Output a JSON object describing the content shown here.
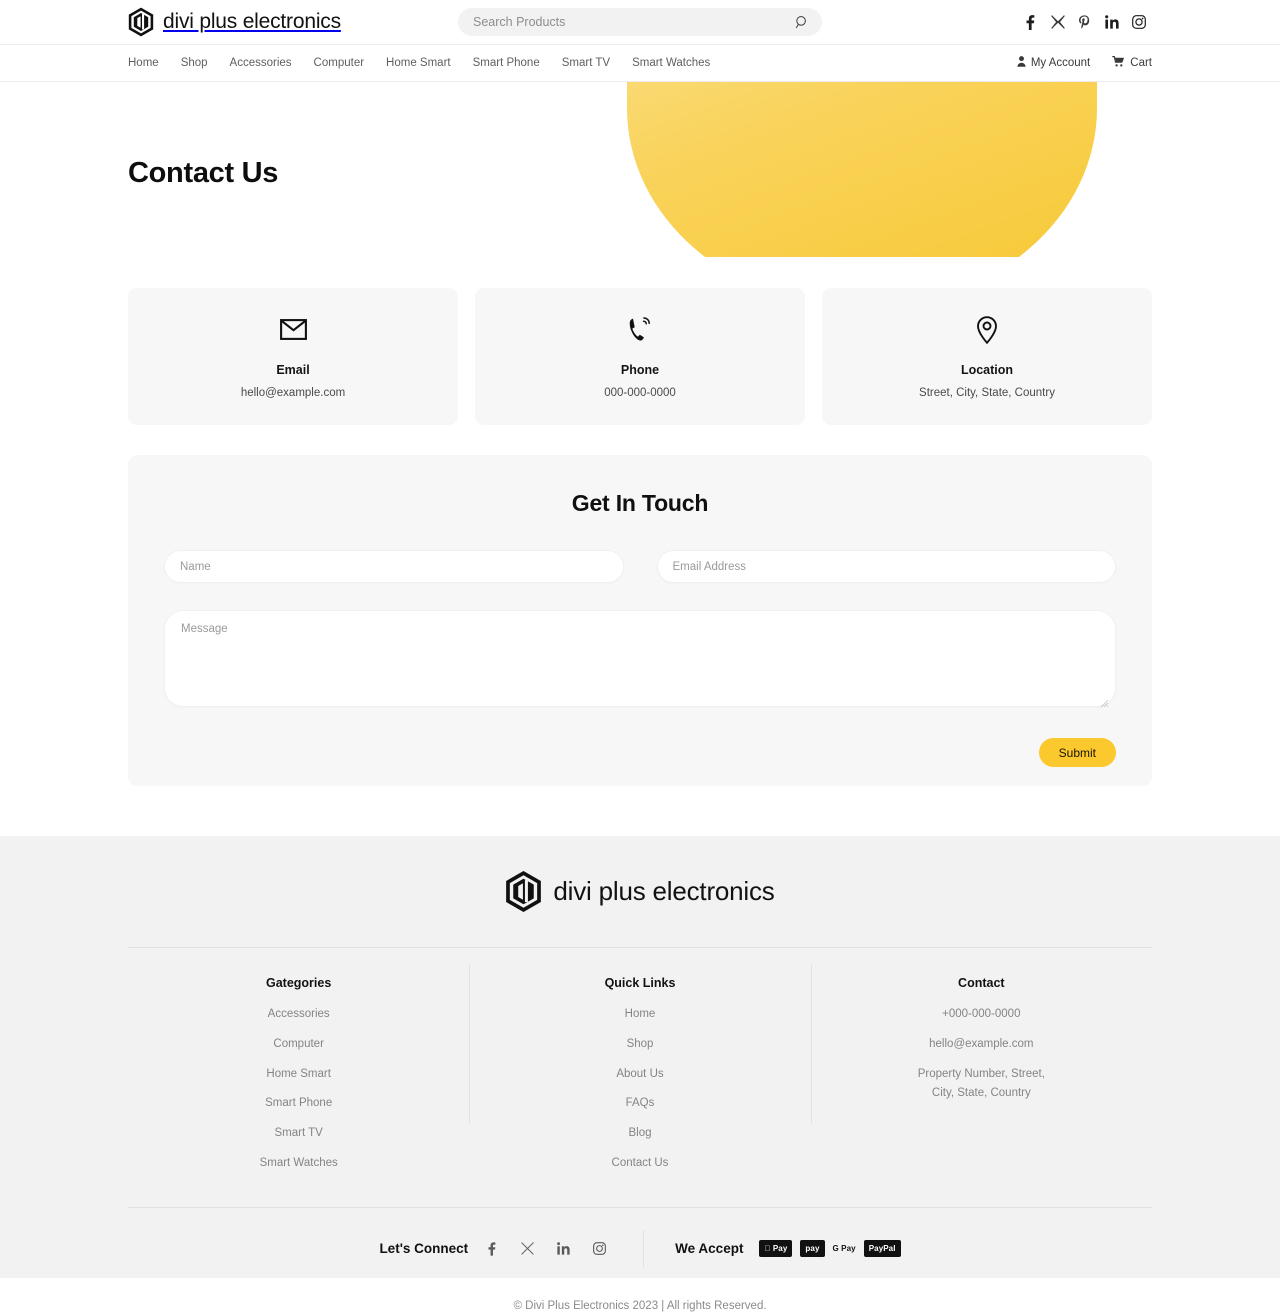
{
  "brand": {
    "name": "divi plus electronics",
    "logo_icon": "hexagon-d-logo"
  },
  "search": {
    "placeholder": "Search Products",
    "value": "",
    "icon": "search-icon"
  },
  "header_social": [
    {
      "name": "facebook-icon",
      "label": "Facebook"
    },
    {
      "name": "x-twitter-icon",
      "label": "X"
    },
    {
      "name": "pinterest-icon",
      "label": "Pinterest"
    },
    {
      "name": "linkedin-icon",
      "label": "LinkedIn"
    },
    {
      "name": "instagram-icon",
      "label": "Instagram"
    }
  ],
  "nav": {
    "links": [
      {
        "label": "Home"
      },
      {
        "label": "Shop"
      },
      {
        "label": "Accessories"
      },
      {
        "label": "Computer"
      },
      {
        "label": "Home Smart"
      },
      {
        "label": "Smart Phone"
      },
      {
        "label": "Smart TV"
      },
      {
        "label": "Smart Watches"
      }
    ],
    "account_label": "My Account",
    "cart_label": "Cart"
  },
  "hero": {
    "title": "Contact Us",
    "accent_color": "#f8c832"
  },
  "contact_cards": [
    {
      "icon": "envelope-icon",
      "title": "Email",
      "value": "hello@example.com"
    },
    {
      "icon": "phone-ringing-icon",
      "title": "Phone",
      "value": "000-000-0000"
    },
    {
      "icon": "map-pin-icon",
      "title": "Location",
      "value": "Street, City, State, Country"
    }
  ],
  "form": {
    "title": "Get In Touch",
    "name_placeholder": "Name",
    "name_value": "",
    "email_placeholder": "Email Address",
    "email_value": "",
    "message_placeholder": "Message",
    "message_value": "",
    "submit_label": "Submit",
    "submit_color": "#fbc82d"
  },
  "footer": {
    "columns": [
      {
        "heading": "Gategories",
        "links": [
          {
            "label": "Accessories"
          },
          {
            "label": "Computer"
          },
          {
            "label": "Home Smart"
          },
          {
            "label": "Smart Phone"
          },
          {
            "label": "Smart TV"
          },
          {
            "label": "Smart Watches"
          }
        ]
      },
      {
        "heading": "Quick Links",
        "links": [
          {
            "label": "Home"
          },
          {
            "label": "Shop"
          },
          {
            "label": "About Us"
          },
          {
            "label": "FAQs"
          },
          {
            "label": "Blog"
          },
          {
            "label": "Contact Us"
          }
        ]
      }
    ],
    "contact": {
      "heading": "Contact",
      "phone": "+000-000-0000",
      "email": "hello@example.com",
      "address_line1": "Property Number, Street,",
      "address_line2": "City, State, Country"
    },
    "connect_label": "Let's Connect",
    "connect_social": [
      {
        "name": "facebook-icon",
        "label": "Facebook"
      },
      {
        "name": "x-twitter-icon",
        "label": "X"
      },
      {
        "name": "linkedin-icon",
        "label": "LinkedIn"
      },
      {
        "name": "instagram-icon",
        "label": "Instagram"
      }
    ],
    "accept_label": "We Accept",
    "payments": [
      {
        "name": "apple-pay-badge",
        "label": "Pay"
      },
      {
        "name": "amazon-pay-badge",
        "label": "pay"
      },
      {
        "name": "google-pay-badge",
        "label": "G Pay"
      },
      {
        "name": "paypal-badge",
        "label": "PayPal"
      }
    ],
    "copyright": "© Divi Plus Electronics 2023 | All rights Reserved."
  }
}
